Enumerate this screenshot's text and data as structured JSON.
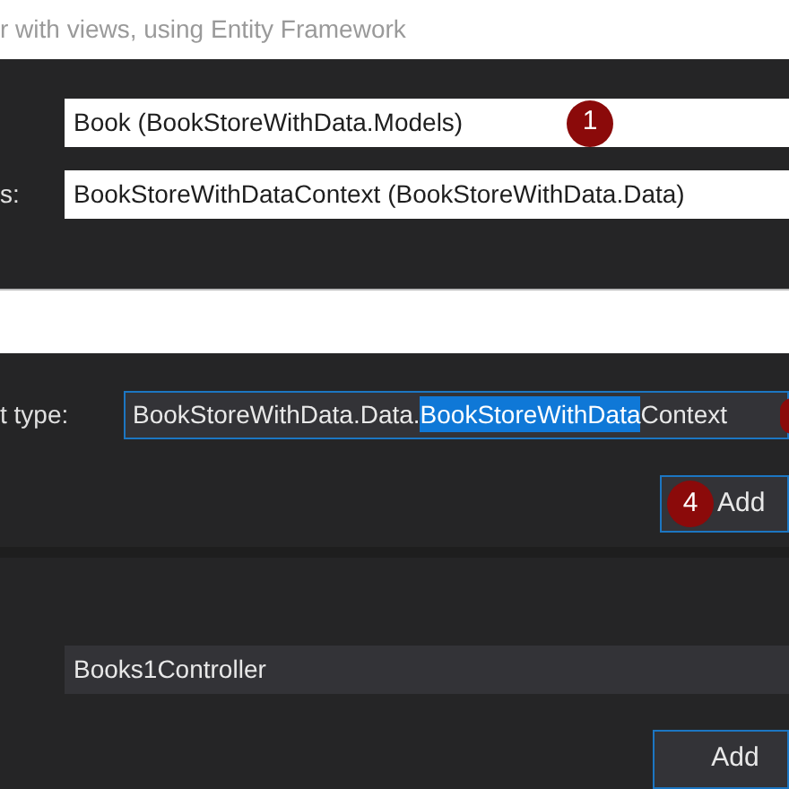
{
  "header": {
    "subtitle": "r with views, using Entity Framework"
  },
  "top_panel": {
    "fields": [
      {
        "value": "Book (BookStoreWithData.Models)",
        "badge": "1"
      },
      {
        "label": "s:",
        "value": "BookStoreWithDataContext (BookStoreWithData.Data)"
      }
    ]
  },
  "middle_panel": {
    "label": "t type:",
    "value_parts": [
      {
        "text": "BookStoreWithData.Data.",
        "selected": false
      },
      {
        "text": "BookStoreWithData",
        "selected": true
      },
      {
        "text": "Context",
        "selected": false
      }
    ],
    "add_button": {
      "label": "Add",
      "badge": "4"
    }
  },
  "bottom_panel": {
    "field": {
      "value": "Books1Controller"
    },
    "add_button": {
      "label": "Add"
    }
  }
}
